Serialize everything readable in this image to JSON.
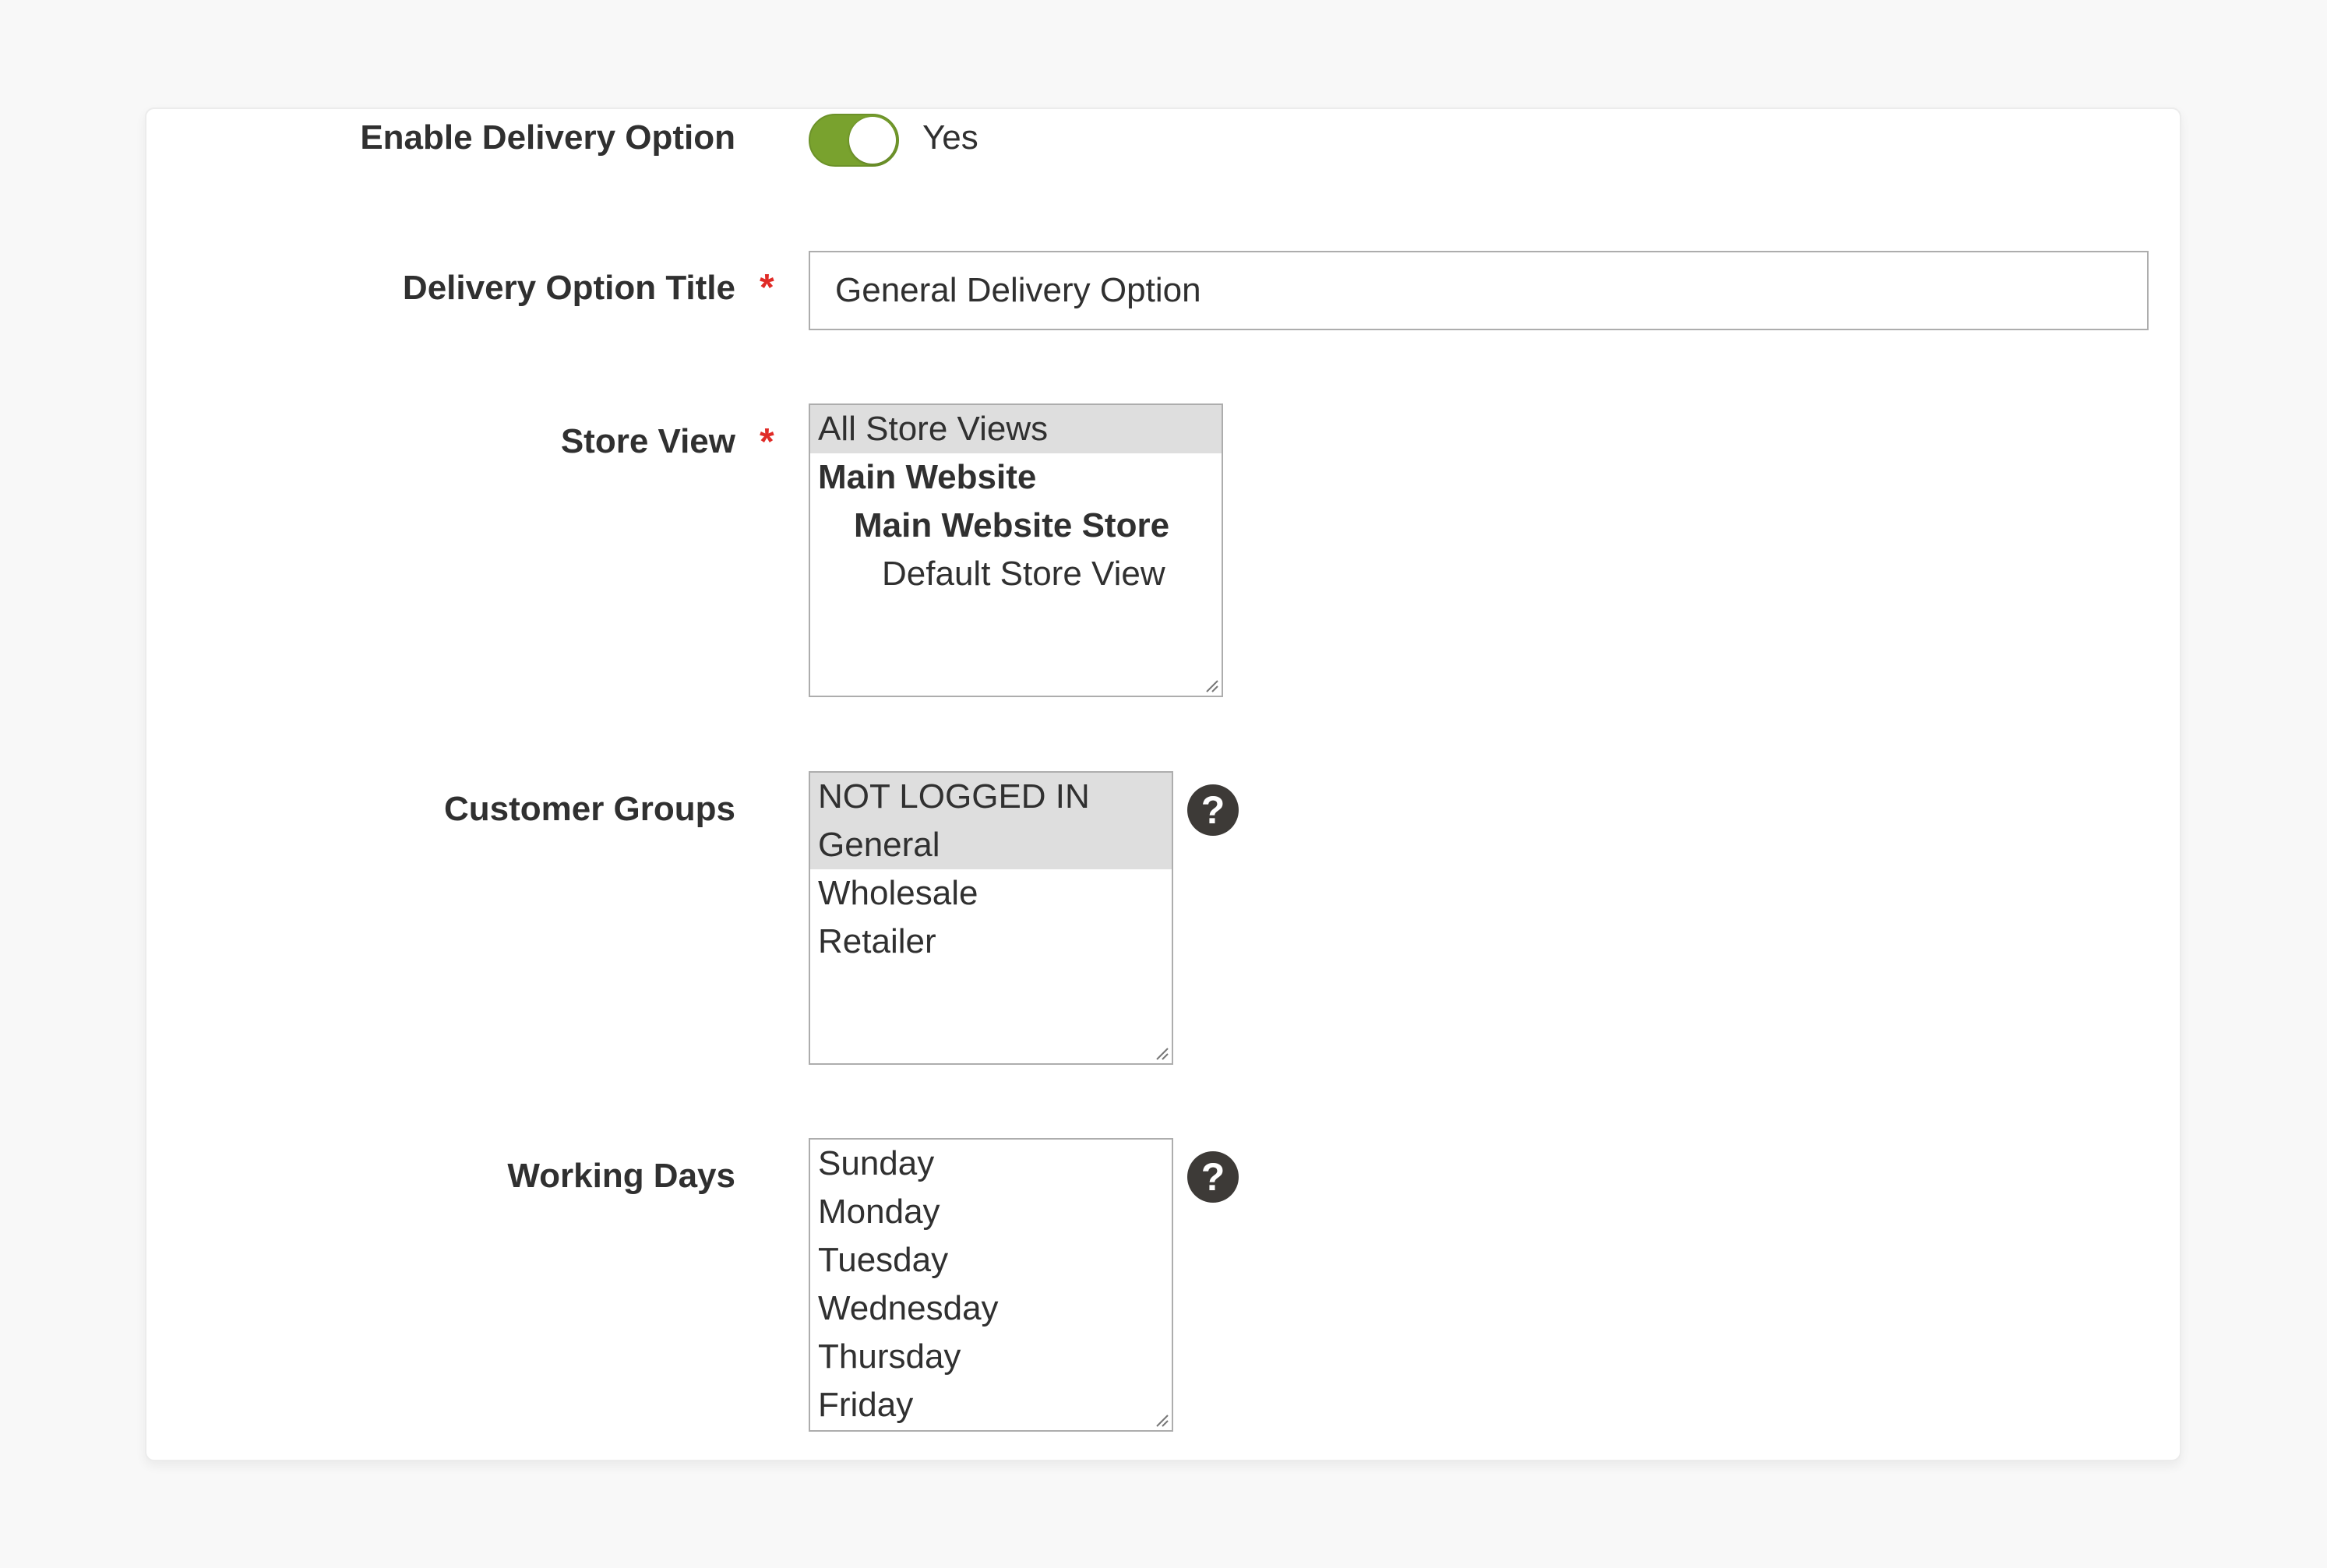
{
  "form": {
    "enable": {
      "label": "Enable Delivery Option",
      "toggle_on": true,
      "toggle_text": "Yes",
      "toggle_color": "#79a22e"
    },
    "title": {
      "label": "Delivery Option Title",
      "required_mark": "*",
      "value": "General Delivery Option"
    },
    "store_view": {
      "label": "Store View",
      "required_mark": "*",
      "options": [
        {
          "text": "All Store Views",
          "selected": true
        },
        {
          "text": "Main Website",
          "selected": false
        },
        {
          "text": "Main Website Store",
          "selected": false
        },
        {
          "text": "Default Store View",
          "selected": false
        }
      ]
    },
    "customer_groups": {
      "label": "Customer Groups",
      "help_icon": "?",
      "options": [
        {
          "text": "NOT LOGGED IN",
          "selected": true
        },
        {
          "text": "General",
          "selected": true
        },
        {
          "text": "Wholesale",
          "selected": false
        },
        {
          "text": "Retailer",
          "selected": false
        }
      ]
    },
    "working_days": {
      "label": "Working Days",
      "help_icon": "?",
      "options": [
        {
          "text": "Sunday",
          "selected": false
        },
        {
          "text": "Monday",
          "selected": false
        },
        {
          "text": "Tuesday",
          "selected": false
        },
        {
          "text": "Wednesday",
          "selected": false
        },
        {
          "text": "Thursday",
          "selected": false
        },
        {
          "text": "Friday",
          "selected": false
        }
      ]
    }
  },
  "colors": {
    "required": "#e02b27",
    "selected_option_bg": "#dedede",
    "help_icon_bg": "#3d3a37"
  }
}
